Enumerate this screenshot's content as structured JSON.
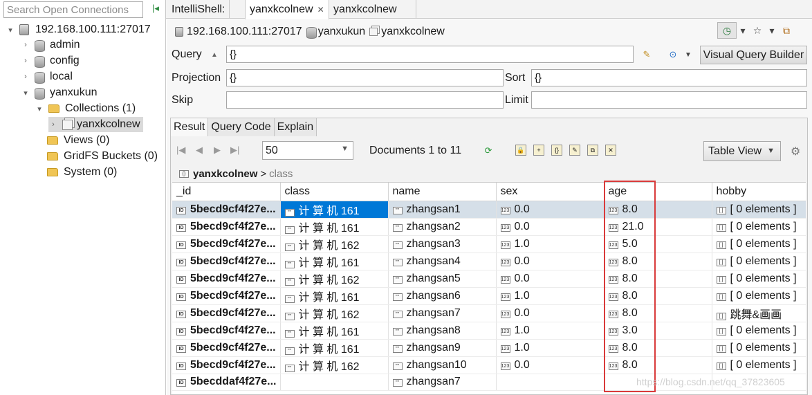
{
  "left": {
    "search_placeholder": "Search Open Connections",
    "connection": "192.168.100.111:27017",
    "databases": [
      {
        "label": "admin"
      },
      {
        "label": "config"
      },
      {
        "label": "local"
      },
      {
        "label": "yanxukun"
      }
    ],
    "collections_label": "Collections (1)",
    "collection_item": "yanxkcolnew",
    "views_label": "Views (0)",
    "gridfs_label": "GridFS Buckets (0)",
    "system_label": "System (0)"
  },
  "tabs": [
    {
      "label": "IntelliShell:"
    },
    {
      "label": "yanxkcolnew",
      "active": true
    },
    {
      "label": "yanxkcolnew"
    }
  ],
  "breadcrumb": {
    "server": "192.168.100.111:27017",
    "database": "yanxukun",
    "collection": "yanxkcolnew"
  },
  "query": {
    "query_label": "Query",
    "query_value": "{}",
    "projection_label": "Projection",
    "projection_value": "{}",
    "sort_label": "Sort",
    "sort_value": "{}",
    "skip_label": "Skip",
    "skip_value": "",
    "limit_label": "Limit",
    "limit_value": "",
    "vqb_label": "Visual Query Builder"
  },
  "result_tabs": [
    {
      "label": "Result",
      "active": true
    },
    {
      "label": "Query Code"
    },
    {
      "label": "Explain"
    }
  ],
  "pager": {
    "page_size": "50",
    "doc_count": "Documents 1 to 11",
    "view_mode": "Table View"
  },
  "path": {
    "collection": "yanxkcolnew",
    "separator": ">",
    "field": "class"
  },
  "table": {
    "columns": [
      "_id",
      "class",
      "name",
      "sex",
      "age",
      "hobby"
    ],
    "rows": [
      {
        "_id": "5becd9cf4f27e...",
        "class": "计 算 机 161",
        "name": "zhangsan1",
        "sex": "0.0",
        "age": "8.0",
        "hobby": "[ 0 elements ]"
      },
      {
        "_id": "5becd9cf4f27e...",
        "class": "计 算 机 161",
        "name": "zhangsan2",
        "sex": "0.0",
        "age": "21.0",
        "hobby": "[ 0 elements ]"
      },
      {
        "_id": "5becd9cf4f27e...",
        "class": "计 算 机 162",
        "name": "zhangsan3",
        "sex": "1.0",
        "age": "5.0",
        "hobby": "[ 0 elements ]"
      },
      {
        "_id": "5becd9cf4f27e...",
        "class": "计 算 机 161",
        "name": "zhangsan4",
        "sex": "0.0",
        "age": "8.0",
        "hobby": "[ 0 elements ]"
      },
      {
        "_id": "5becd9cf4f27e...",
        "class": "计 算 机 162",
        "name": "zhangsan5",
        "sex": "0.0",
        "age": "8.0",
        "hobby": "[ 0 elements ]"
      },
      {
        "_id": "5becd9cf4f27e...",
        "class": "计 算 机 161",
        "name": "zhangsan6",
        "sex": "1.0",
        "age": "8.0",
        "hobby": "[ 0 elements ]"
      },
      {
        "_id": "5becd9cf4f27e...",
        "class": "计 算 机 162",
        "name": "zhangsan7",
        "sex": "0.0",
        "age": "8.0",
        "hobby": "跳舞&画画"
      },
      {
        "_id": "5becd9cf4f27e...",
        "class": "计 算 机 161",
        "name": "zhangsan8",
        "sex": "1.0",
        "age": "3.0",
        "hobby": "[ 0 elements ]"
      },
      {
        "_id": "5becd9cf4f27e...",
        "class": "计 算 机 161",
        "name": "zhangsan9",
        "sex": "1.0",
        "age": "8.0",
        "hobby": "[ 0 elements ]"
      },
      {
        "_id": "5becd9cf4f27e...",
        "class": "计 算 机 162",
        "name": "zhangsan10",
        "sex": "0.0",
        "age": "8.0",
        "hobby": "[ 0 elements ]"
      },
      {
        "_id": "5becddaf4f27e...",
        "class": "",
        "name": "zhangsan7",
        "sex": "",
        "age": "",
        "hobby": ""
      }
    ]
  },
  "watermark": "https://blog.csdn.net/qq_37823605",
  "colors": {
    "selection": "#0078d7",
    "selected_row": "#d5dfe8",
    "highlight_box": "#d93a3a"
  }
}
